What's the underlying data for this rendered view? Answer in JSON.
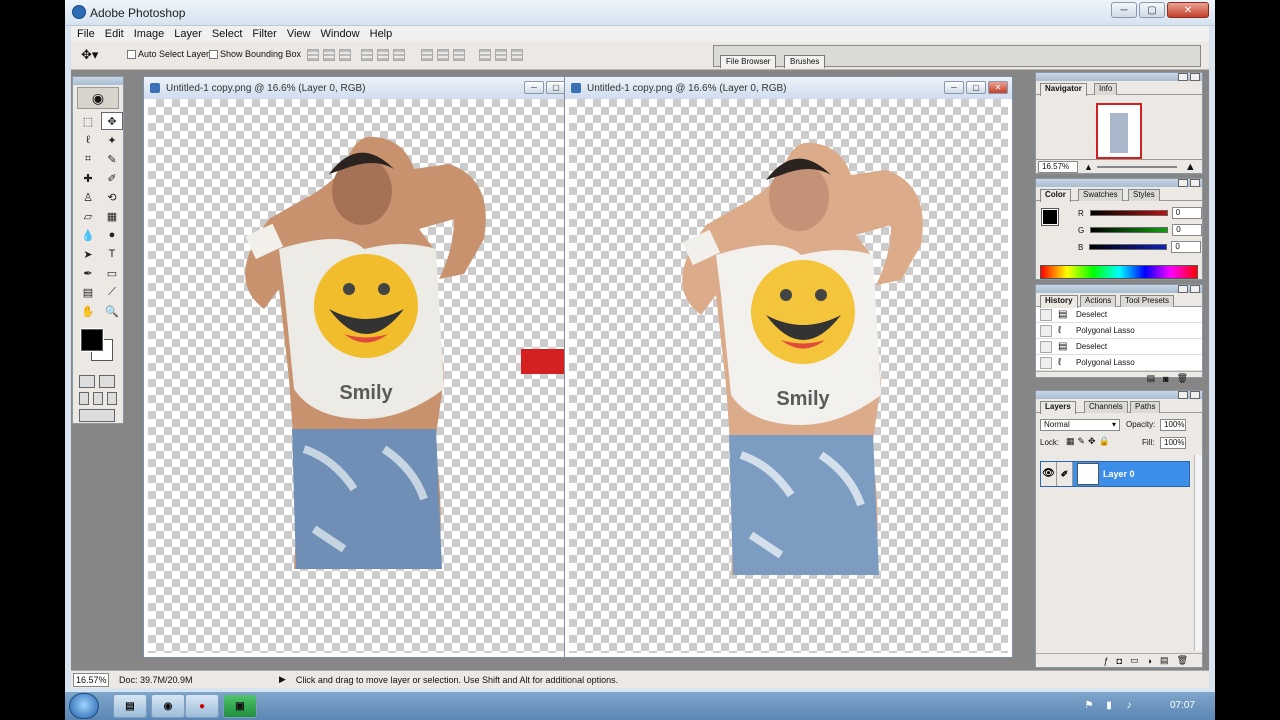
{
  "window": {
    "title": "Adobe Photoshop",
    "controls": {
      "minimize": "─",
      "maximize": "▢",
      "close": "✕"
    }
  },
  "menu": [
    "File",
    "Edit",
    "Image",
    "Layer",
    "Select",
    "Filter",
    "View",
    "Window",
    "Help"
  ],
  "options": {
    "auto_select_label": "Auto Select Layer",
    "bounding_box_label": "Show Bounding Box",
    "palette_well_tabs": [
      "File Browser",
      "Brushes"
    ]
  },
  "documents": [
    {
      "title": "Untitled-1 copy.png @ 16.6% (Layer 0, RGB)",
      "shirt_text": "Smily"
    },
    {
      "title": "Untitled-1 copy.png @ 16.6% (Layer 0, RGB)",
      "shirt_text": "Smily"
    }
  ],
  "arrow_color": "#d42020",
  "navigator": {
    "tabs": [
      "Navigator",
      "Info"
    ],
    "zoom": "16.57%"
  },
  "color_panel": {
    "tabs": [
      "Color",
      "Swatches",
      "Styles"
    ],
    "channels": [
      {
        "label": "R",
        "value": "0",
        "color": "#c01010"
      },
      {
        "label": "G",
        "value": "0",
        "color": "#10a010"
      },
      {
        "label": "B",
        "value": "0",
        "color": "#1020c0"
      }
    ]
  },
  "history": {
    "tabs": [
      "History",
      "Actions",
      "Tool Presets"
    ],
    "items": [
      "Deselect",
      "Polygonal Lasso",
      "Deselect",
      "Polygonal Lasso"
    ]
  },
  "layers": {
    "tabs": [
      "Layers",
      "Channels",
      "Paths"
    ],
    "blend_mode": "Normal",
    "opacity_label": "Opacity:",
    "opacity": "100%",
    "lock_label": "Lock:",
    "fill_label": "Fill:",
    "fill": "100%",
    "layer_name": "Layer 0"
  },
  "status": {
    "zoom": "16.57%",
    "doc": "Doc: 39.7M/20.9M",
    "message": "Click and drag to move layer or selection.  Use Shift and Alt for additional options."
  },
  "taskbar": {
    "clock": "07:07"
  },
  "accent": "#3c8ee8"
}
